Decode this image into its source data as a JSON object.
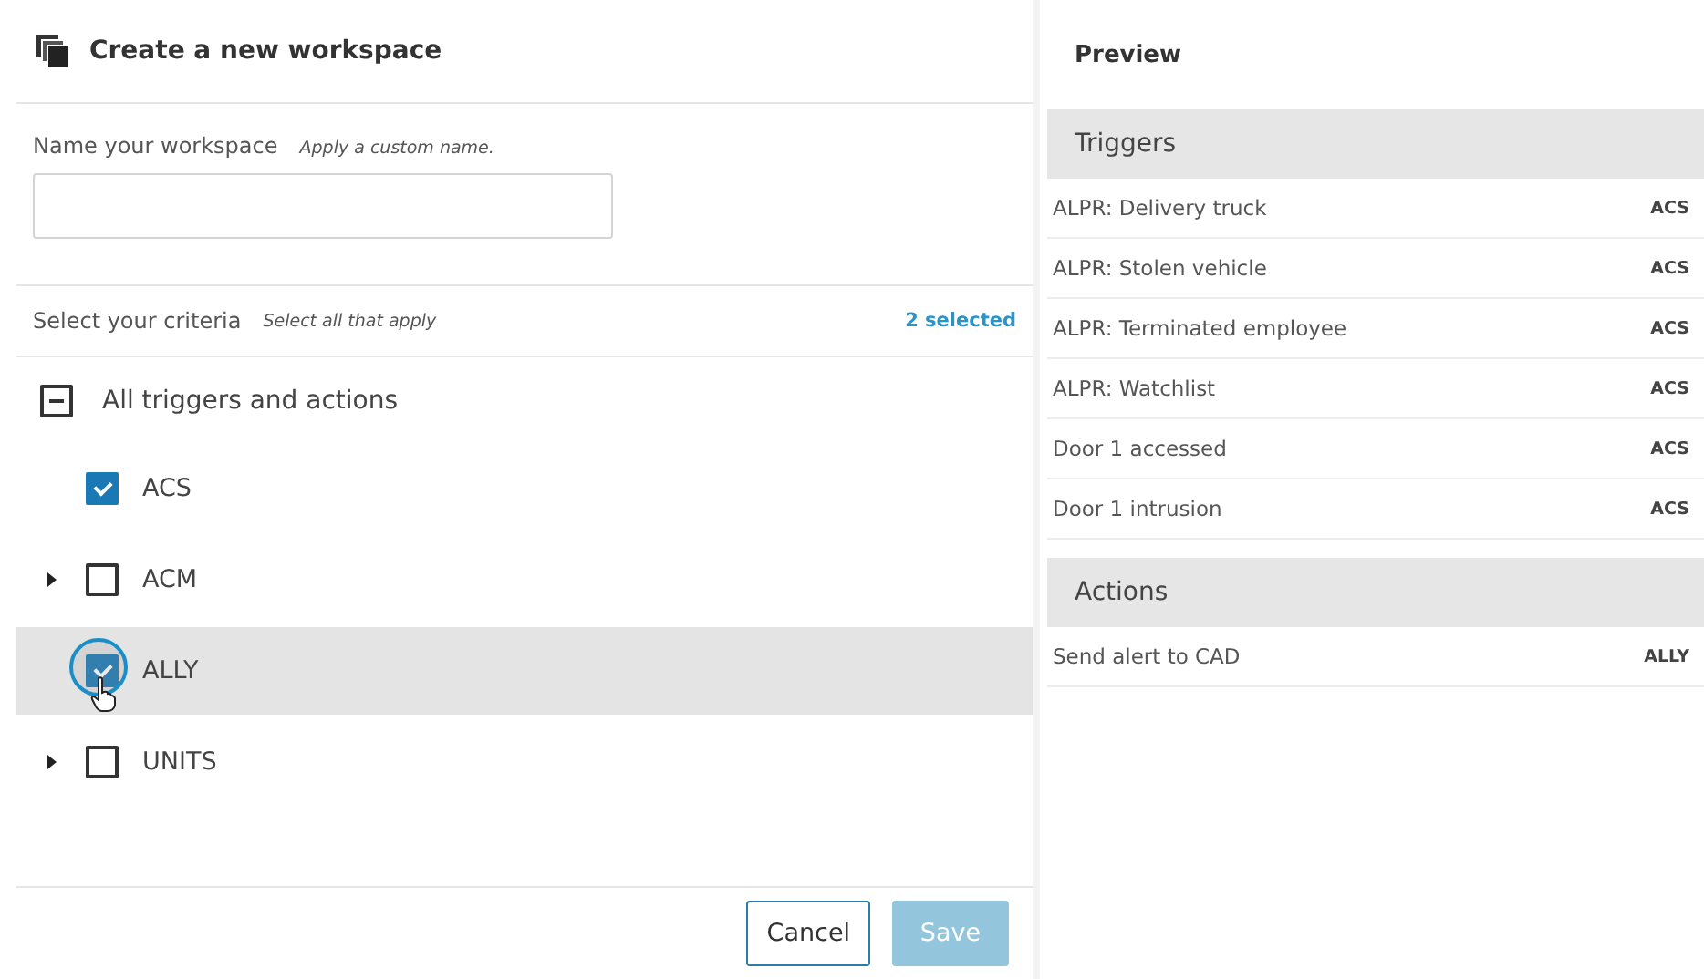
{
  "dialog": {
    "title": "Create a new workspace"
  },
  "name_field": {
    "label": "Name your workspace",
    "hint": "Apply a custom name."
  },
  "criteria": {
    "label": "Select your criteria",
    "hint": "Select all that apply",
    "count": "2 selected",
    "tree": {
      "label": "All triggers and actions",
      "indeterminate": true,
      "children": [
        {
          "label": "ACS",
          "checked": true,
          "expandable": false,
          "highlighted": false,
          "focused": false
        },
        {
          "label": "ACM",
          "checked": false,
          "expandable": true,
          "highlighted": false,
          "focused": false
        },
        {
          "label": "ALLY",
          "checked": true,
          "expandable": false,
          "highlighted": true,
          "focused": true
        },
        {
          "label": "UNITS",
          "checked": false,
          "expandable": true,
          "highlighted": false,
          "focused": false
        }
      ]
    }
  },
  "buttons": [
    {
      "label": "Cancel",
      "kind": "secondary",
      "disabled": false
    },
    {
      "label": "Save",
      "kind": "primary",
      "disabled": true
    }
  ],
  "preview": {
    "title": "Preview",
    "sections": [
      {
        "title": "Triggers",
        "items": [
          {
            "name": "ALPR: Delivery truck",
            "source": "ACS"
          },
          {
            "name": "ALPR: Stolen vehicle",
            "source": "ACS"
          },
          {
            "name": "ALPR: Terminated employee",
            "source": "ACS"
          },
          {
            "name": "ALPR: Watchlist",
            "source": "ACS"
          },
          {
            "name": "Door 1 accessed",
            "source": "ACS"
          },
          {
            "name": "Door 1 intrusion",
            "source": "ACS"
          }
        ]
      },
      {
        "title": "Actions",
        "items": [
          {
            "name": "Send alert to CAD",
            "source": "ALLY"
          }
        ]
      }
    ]
  }
}
